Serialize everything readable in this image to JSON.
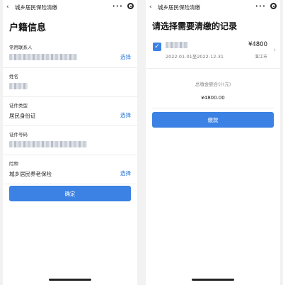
{
  "left": {
    "nav": {
      "back": "‹",
      "title": "城乡居民保险清缴",
      "menu": "•••"
    },
    "page_title": "户籍信息",
    "fields": [
      {
        "label": "常用联系人",
        "value": "",
        "action": "选择"
      },
      {
        "label": "姓名",
        "value": "",
        "action": ""
      },
      {
        "label": "证件类型",
        "value": "居民身份证",
        "action": "选择"
      },
      {
        "label": "证件号码",
        "value": "",
        "action": ""
      },
      {
        "label": "险种",
        "value": "城乡居民养老保险",
        "action": "选择"
      }
    ],
    "confirm_label": "确定"
  },
  "right": {
    "nav": {
      "back": "‹",
      "title": "城乡居民保险清缴",
      "menu": "•••"
    },
    "page_title": "请选择需要清缴的记录",
    "record": {
      "check": "✓",
      "period": "2022-01-01至2022-12-31",
      "amount": "¥4800",
      "city": "湛江市",
      "chevron": "›"
    },
    "total_label": "总缴金额合计(元)",
    "total_value": "¥4800.00",
    "pay_label": "缴款"
  },
  "colors": {
    "accent": "#3b82e4",
    "link": "#1e6fd9"
  },
  "icons": [
    "back-arrow-icon",
    "more-icon",
    "close-ring-icon",
    "checkbox-checked-icon",
    "chevron-right-icon"
  ]
}
